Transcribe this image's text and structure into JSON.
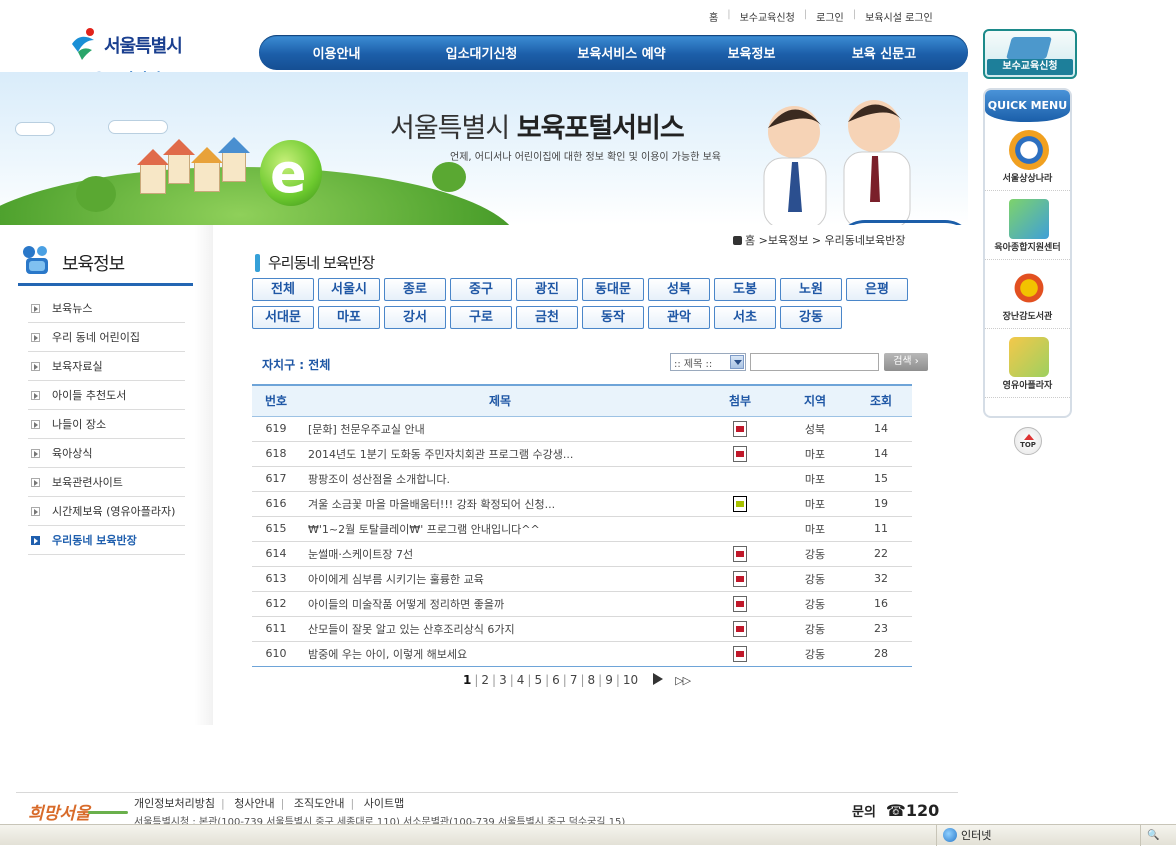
{
  "site": {
    "logo_line1": "서울특별시",
    "logo_line2": "보육포털서비스"
  },
  "util_nav": [
    "홈",
    "보수교육신청",
    "로그인",
    "보육시설 로그인"
  ],
  "gnb": [
    "이용안내",
    "입소대기신청",
    "보육서비스 예약",
    "보육정보",
    "보육 신문고"
  ],
  "banner": {
    "title_light": "서울특별시",
    "title_bold": "보육포털서비스",
    "subtitle": "언제, 어디서나 어린이집에 대한 정보 확인 및 이용이 가능한 보육"
  },
  "lnb": {
    "title": "보육정보",
    "items": [
      "보육뉴스",
      "우리 동네 어린이집",
      "보육자료실",
      "아이들 추천도서",
      "나들이 장소",
      "육아상식",
      "보육관련사이트",
      "시간제보육 (영유아플라자)",
      "우리동네 보육반장"
    ],
    "active_index": 8
  },
  "breadcrumb": [
    "홈",
    "보육정보",
    "우리동네보육반장"
  ],
  "content_title": "우리동네 보육반장",
  "districts": [
    "전체",
    "서울시",
    "종로",
    "중구",
    "광진",
    "동대문",
    "성북",
    "도봉",
    "노원",
    "은평",
    "서대문",
    "마포",
    "강서",
    "구로",
    "금천",
    "동작",
    "관악",
    "서초",
    "강동"
  ],
  "region_label": "자치구 : 전체",
  "search": {
    "select_value": ":: 제목 ::",
    "input_value": "",
    "button_label": "검색 ›"
  },
  "board": {
    "headers": [
      "번호",
      "제목",
      "첨부",
      "지역",
      "조회"
    ],
    "rows": [
      {
        "no": "619",
        "title": "[문화] 천문우주교실 안내",
        "attach": "doc",
        "region": "성북",
        "views": "14"
      },
      {
        "no": "618",
        "title": "2014년도 1분기 도화동 주민자치회관 프로그램 수강생...",
        "attach": "doc",
        "region": "마포",
        "views": "14"
      },
      {
        "no": "617",
        "title": "팡팡조이 성산점을 소개합니다.",
        "attach": "",
        "region": "마포",
        "views": "15"
      },
      {
        "no": "616",
        "title": "겨울 소금꽃 마을 마을배움터!!! 강좌 확정되어 신청...",
        "attach": "img",
        "region": "마포",
        "views": "19"
      },
      {
        "no": "615",
        "title": "₩'1~2월 토탈클레이₩' 프로그램 안내입니다^^",
        "attach": "",
        "region": "마포",
        "views": "11"
      },
      {
        "no": "614",
        "title": "눈썰매·스케이트장 7선",
        "attach": "doc",
        "region": "강동",
        "views": "22"
      },
      {
        "no": "613",
        "title": "아이에게 심부름 시키기는 훌륭한 교육",
        "attach": "doc",
        "region": "강동",
        "views": "32"
      },
      {
        "no": "612",
        "title": "아이들의 미술작품 어떻게 정리하면 좋을까",
        "attach": "doc",
        "region": "강동",
        "views": "16"
      },
      {
        "no": "611",
        "title": "산모들이 잘못 알고 있는 산후조리상식 6가지",
        "attach": "doc",
        "region": "강동",
        "views": "23"
      },
      {
        "no": "610",
        "title": "밤중에 우는 아이, 이렇게 해보세요",
        "attach": "doc",
        "region": "강동",
        "views": "28"
      }
    ]
  },
  "pager": {
    "pages": [
      "1",
      "2",
      "3",
      "4",
      "5",
      "6",
      "7",
      "8",
      "9",
      "10"
    ],
    "current": "1",
    "next_label": "▷▷"
  },
  "quick_menu": {
    "edu_button": "보수교육신청",
    "header": "QUICK MENU",
    "items": [
      "서울상상나라",
      "육아종합지원센터",
      "장난감도서관",
      "영유아플라자"
    ],
    "top_label": "TOP"
  },
  "footer": {
    "logo": "희망서울",
    "links": [
      "개인정보처리방침",
      "청사안내",
      "조직도안내",
      "사이트맵"
    ],
    "address": "서울특별시청 : 본관(100-739 서울특별시 중구 세종대로 110)  서소문별관(100-739 서울특별시 중구 덕수궁길 15)",
    "call_label": "문의",
    "call_number": "☎120"
  },
  "statusbar": {
    "zone": "인터넷",
    "zoom": "🔍"
  },
  "colors": {
    "brand_blue": "#1c5ea9",
    "district_text": "#1f57a5",
    "board_header_bg": "#e9f3fb"
  }
}
